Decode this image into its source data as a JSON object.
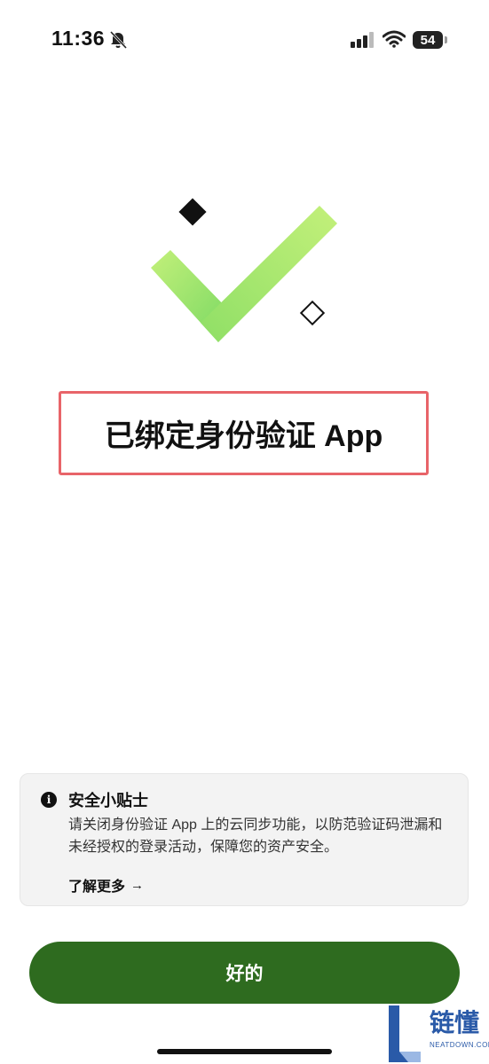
{
  "status_bar": {
    "time": "11:36",
    "battery": "54"
  },
  "title": "已绑定身份验证 App",
  "tip": {
    "title": "安全小贴士",
    "body": "请关闭身份验证 App 上的云同步功能，以防范验证码泄漏和未经授权的登录活动，保障您的资产安全。",
    "link": "了解更多"
  },
  "ok_button": "好的",
  "watermark": {
    "text": "链懂",
    "sub": "NEATDOWN.COM"
  },
  "colors": {
    "accent": "#2e6b1f",
    "check_light": "#b8ee72",
    "check_dark": "#7dda62",
    "highlight_border": "#e86469"
  },
  "icons": [
    "bell-slash-icon",
    "signal-icon",
    "wifi-icon",
    "battery-icon",
    "checkmark-icon",
    "info-icon",
    "arrow-right-icon"
  ]
}
